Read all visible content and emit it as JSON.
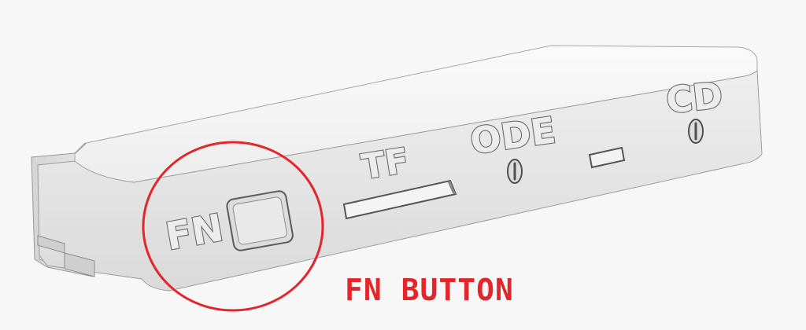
{
  "panel": {
    "labels": {
      "fn": "FN",
      "tf": "TF",
      "ode": "ODE",
      "cd": "CD"
    }
  },
  "callout": {
    "text": "FN BUTTON",
    "color": "#e3262b"
  },
  "colors": {
    "background": "#f7f7f7",
    "panel_face": "#e6e6e6",
    "panel_top": "#f2f2f2",
    "engrave_edge": "#6a6a6a"
  }
}
